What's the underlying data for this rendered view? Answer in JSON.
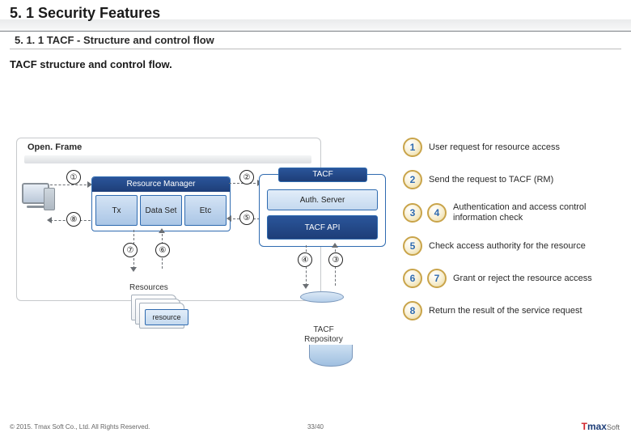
{
  "heading": {
    "h1": "5. 1 Security Features",
    "h2": "5. 1. 1 TACF - Structure and control flow",
    "body": "TACF structure and control flow."
  },
  "openframe_label": "Open. Frame",
  "rm": {
    "title": "Resource Manager",
    "cells": [
      "Tx",
      "Data Set",
      "Etc"
    ]
  },
  "tacf": {
    "title": "TACF",
    "auth": "Auth. Server",
    "api": "TACF API"
  },
  "resources": {
    "group_label": "Resources",
    "item": "resource"
  },
  "repo": "TACF Repository",
  "marks": {
    "m1": "①",
    "m2": "②",
    "m3": "③",
    "m4": "④",
    "m5": "⑤",
    "m6": "⑥",
    "m7": "⑦",
    "m8": "⑧"
  },
  "legend": [
    {
      "badges": [
        "1"
      ],
      "text": "User request for resource access"
    },
    {
      "badges": [
        "2"
      ],
      "text": "Send the request to TACF (RM)"
    },
    {
      "badges": [
        "3",
        "4"
      ],
      "text": "Authentication and access control information check"
    },
    {
      "badges": [
        "5"
      ],
      "text": "Check access authority for the resource"
    },
    {
      "badges": [
        "6",
        "7"
      ],
      "text": "Grant or reject the resource access"
    },
    {
      "badges": [
        "8"
      ],
      "text": "Return the result of the service request"
    }
  ],
  "footer": {
    "copyright": "© 2015. Tmax Soft Co., Ltd. All Rights Reserved.",
    "page": "33/40",
    "logo_t": "T",
    "logo_max": "max",
    "logo_soft": "Soft"
  }
}
